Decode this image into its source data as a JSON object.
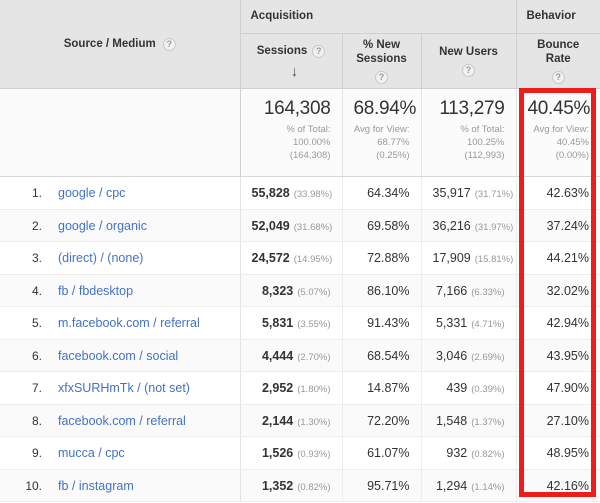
{
  "table": {
    "dimension_header": "Source / Medium",
    "groups": [
      {
        "label": "Acquisition",
        "span": 3
      },
      {
        "label": "Behavior",
        "span": 1
      }
    ],
    "columns": [
      {
        "label": "Sessions",
        "help": "?",
        "sorted": true,
        "sort_arrow": "↓"
      },
      {
        "label": "% New\nSessions",
        "help": "?",
        "sorted": false,
        "sort_arrow": ""
      },
      {
        "label": "New Users",
        "help": "?",
        "sorted": false,
        "sort_arrow": ""
      },
      {
        "label": "Bounce Rate",
        "help": "?",
        "sorted": false,
        "sort_arrow": ""
      }
    ],
    "summary": {
      "sessions": {
        "value": "164,308",
        "line1": "% of Total:",
        "line2": "100.00%",
        "line3": "(164,308)"
      },
      "pct_new_sessions": {
        "value": "68.94%",
        "line1": "Avg for View:",
        "line2": "68.77%",
        "line3": "(0.25%)"
      },
      "new_users": {
        "value": "113,279",
        "line1": "% of Total:",
        "line2": "100.25%",
        "line3": "(112,993)"
      },
      "bounce_rate": {
        "value": "40.45%",
        "line1": "Avg for View:",
        "line2": "40.45%",
        "line3": "(0.00%)"
      }
    },
    "rows": [
      {
        "index": "1.",
        "source": "google / cpc",
        "sessions": "55,828",
        "sessions_pct": "(33.98%)",
        "pct_new_sessions": "64.34%",
        "new_users": "35,917",
        "new_users_pct": "(31.71%)",
        "bounce_rate": "42.63%"
      },
      {
        "index": "2.",
        "source": "google / organic",
        "sessions": "52,049",
        "sessions_pct": "(31.68%)",
        "pct_new_sessions": "69.58%",
        "new_users": "36,216",
        "new_users_pct": "(31.97%)",
        "bounce_rate": "37.24%"
      },
      {
        "index": "3.",
        "source": "(direct) / (none)",
        "sessions": "24,572",
        "sessions_pct": "(14.95%)",
        "pct_new_sessions": "72.88%",
        "new_users": "17,909",
        "new_users_pct": "(15.81%)",
        "bounce_rate": "44.21%"
      },
      {
        "index": "4.",
        "source": "fb / fbdesktop",
        "sessions": "8,323",
        "sessions_pct": "(5.07%)",
        "pct_new_sessions": "86.10%",
        "new_users": "7,166",
        "new_users_pct": "(6.33%)",
        "bounce_rate": "32.02%"
      },
      {
        "index": "5.",
        "source": "m.facebook.com / referral",
        "sessions": "5,831",
        "sessions_pct": "(3.55%)",
        "pct_new_sessions": "91.43%",
        "new_users": "5,331",
        "new_users_pct": "(4.71%)",
        "bounce_rate": "42.94%"
      },
      {
        "index": "6.",
        "source": "facebook.com / social",
        "sessions": "4,444",
        "sessions_pct": "(2.70%)",
        "pct_new_sessions": "68.54%",
        "new_users": "3,046",
        "new_users_pct": "(2.69%)",
        "bounce_rate": "43.95%"
      },
      {
        "index": "7.",
        "source": "xfxSURHmTk / (not set)",
        "sessions": "2,952",
        "sessions_pct": "(1.80%)",
        "pct_new_sessions": "14.87%",
        "new_users": "439",
        "new_users_pct": "(0.39%)",
        "bounce_rate": "47.90%"
      },
      {
        "index": "8.",
        "source": "facebook.com / referral",
        "sessions": "2,144",
        "sessions_pct": "(1.30%)",
        "pct_new_sessions": "72.20%",
        "new_users": "1,548",
        "new_users_pct": "(1.37%)",
        "bounce_rate": "27.10%"
      },
      {
        "index": "9.",
        "source": "mucca / cpc",
        "sessions": "1,526",
        "sessions_pct": "(0.93%)",
        "pct_new_sessions": "61.07%",
        "new_users": "932",
        "new_users_pct": "(0.82%)",
        "bounce_rate": "48.95%"
      },
      {
        "index": "10.",
        "source": "fb / instagram",
        "sessions": "1,352",
        "sessions_pct": "(0.82%)",
        "pct_new_sessions": "95.71%",
        "new_users": "1,294",
        "new_users_pct": "(1.14%)",
        "bounce_rate": "42.16%"
      }
    ]
  },
  "annotation": {
    "highlight_color": "#ee1d1d",
    "highlight_target": "Bounce Rate"
  }
}
